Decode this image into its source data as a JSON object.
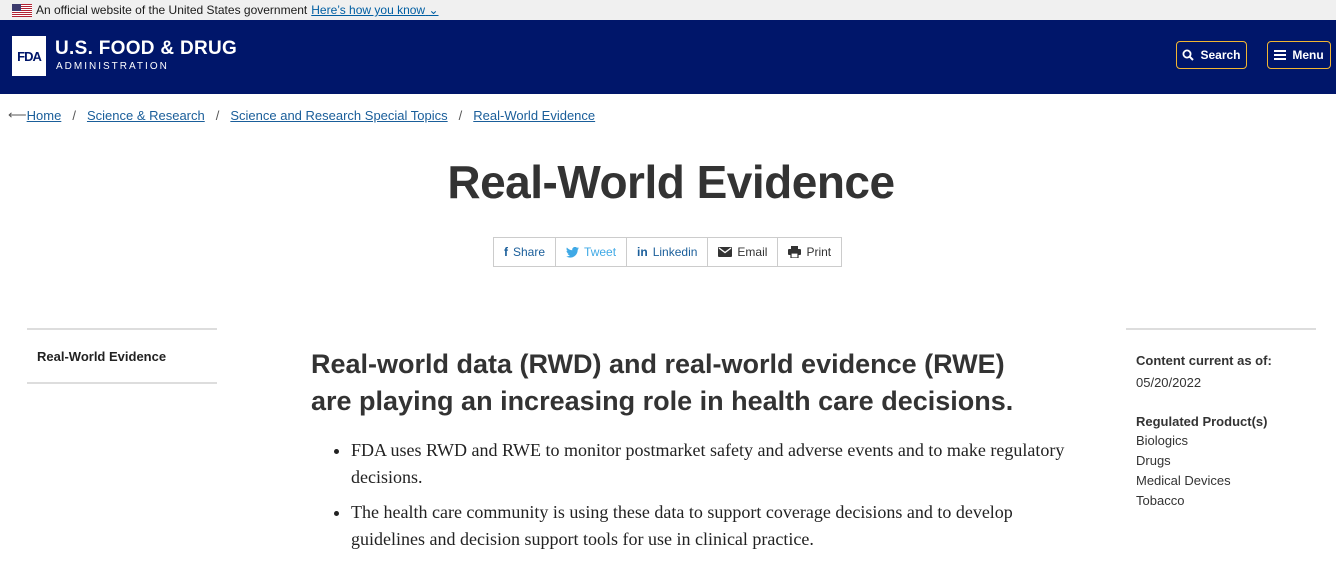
{
  "gov_banner": {
    "text": "An official website of the United States government",
    "link": "Here’s how you know"
  },
  "header": {
    "logo_mark": "FDA",
    "title": "U.S. FOOD & DRUG",
    "subtitle": "ADMINISTRATION",
    "search_label": "Search",
    "menu_label": "Menu",
    "accent_color": "#f2b632",
    "bg_color": "#00166a"
  },
  "breadcrumb": [
    "Home",
    "Science & Research",
    "Science and Research Special Topics",
    "Real-World Evidence"
  ],
  "page_title": "Real-World Evidence",
  "share": {
    "share": "Share",
    "tweet": "Tweet",
    "linkedin": "Linkedin",
    "email": "Email",
    "print": "Print"
  },
  "left_nav": {
    "item": "Real-World Evidence"
  },
  "main": {
    "lead": "Real-world data (RWD) and real-world evidence (RWE) are playing an increasing role in health care decisions.",
    "bullets": [
      "FDA uses RWD and RWE to monitor postmarket safety and adverse events and to make regulatory decisions.",
      "The health care community is using these data to support coverage decisions and to develop guidelines and decision support tools for use in clinical practice."
    ]
  },
  "sidebar": {
    "current_label": "Content current as of:",
    "current_date": "05/20/2022",
    "products_label": "Regulated Product(s)",
    "products": [
      "Biologics",
      "Drugs",
      "Medical Devices",
      "Tobacco"
    ]
  }
}
